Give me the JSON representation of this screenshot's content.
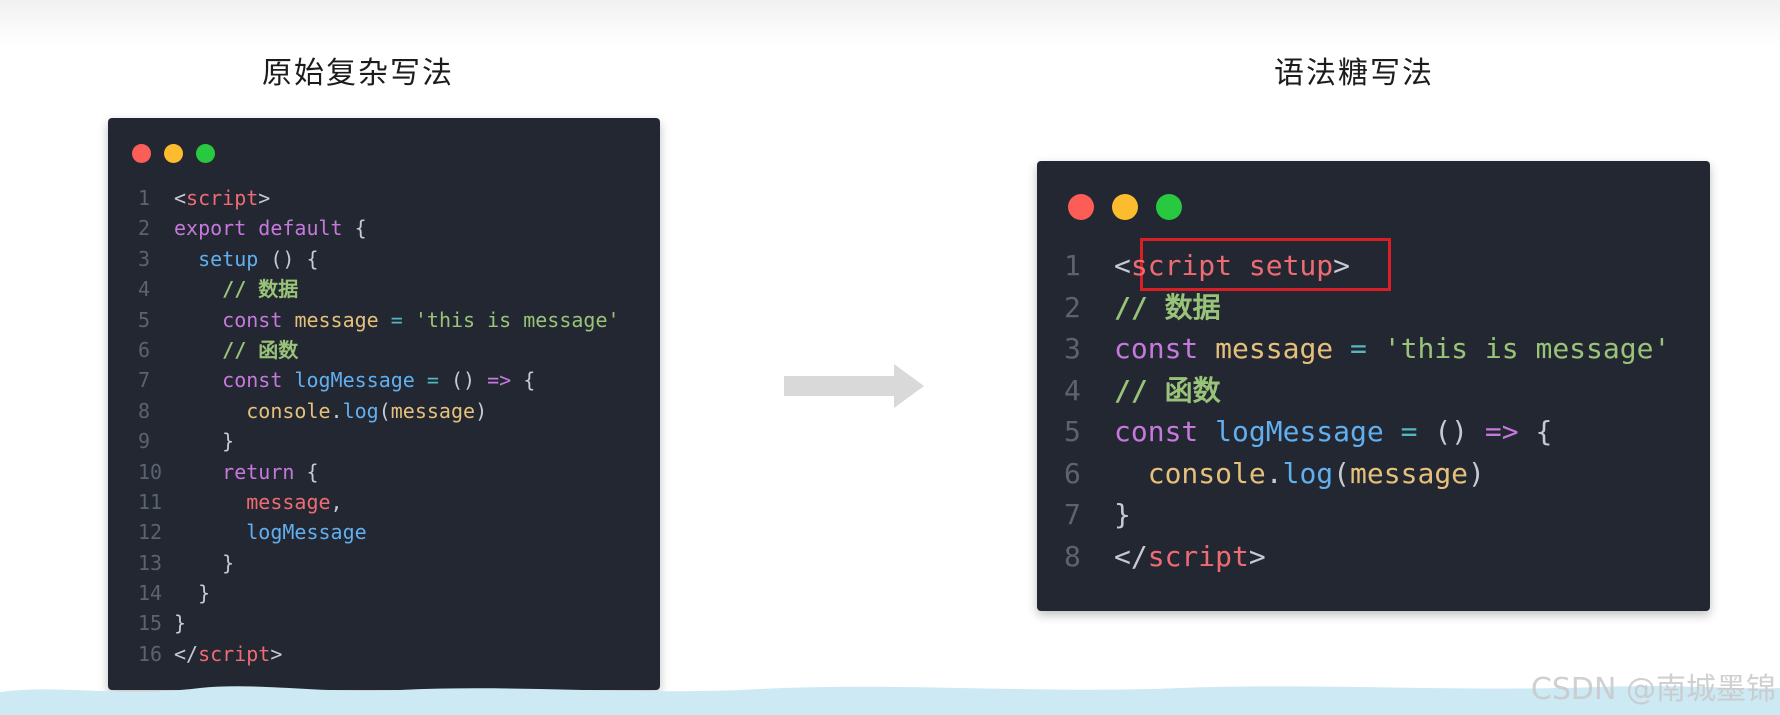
{
  "headings": {
    "left": "原始复杂写法",
    "right": "语法糖写法"
  },
  "colors": {
    "window_bg": "#232731",
    "dot_red": "#fc5d57",
    "dot_yellow": "#fdbc2e",
    "dot_green": "#28c840",
    "highlight_border": "#d81f26",
    "arrow": "#d9d9d9",
    "band": "#cde9f3"
  },
  "left_code": [
    [
      {
        "t": "<",
        "c": "t-punct"
      },
      {
        "t": "script",
        "c": "t-tag"
      },
      {
        "t": ">",
        "c": "t-punct"
      }
    ],
    [
      {
        "t": "export default",
        "c": "t-kw"
      },
      {
        "t": " {",
        "c": "t-punct"
      }
    ],
    [
      {
        "t": "  "
      },
      {
        "t": "setup",
        "c": "t-fn"
      },
      {
        "t": " () {",
        "c": "t-punct"
      }
    ],
    [
      {
        "t": "    "
      },
      {
        "t": "// 数据",
        "c": "t-comment"
      }
    ],
    [
      {
        "t": "    "
      },
      {
        "t": "const",
        "c": "t-kw"
      },
      {
        "t": " "
      },
      {
        "t": "message",
        "c": "t-var"
      },
      {
        "t": " = ",
        "c": "t-op"
      },
      {
        "t": "'this is message'",
        "c": "t-str"
      }
    ],
    [
      {
        "t": "    "
      },
      {
        "t": "// 函数",
        "c": "t-comment"
      }
    ],
    [
      {
        "t": "    "
      },
      {
        "t": "const",
        "c": "t-kw"
      },
      {
        "t": " "
      },
      {
        "t": "logMessage",
        "c": "t-fn"
      },
      {
        "t": " = ",
        "c": "t-op"
      },
      {
        "t": "() ",
        "c": "t-punct"
      },
      {
        "t": "=>",
        "c": "t-kw"
      },
      {
        "t": " {",
        "c": "t-punct"
      }
    ],
    [
      {
        "t": "      "
      },
      {
        "t": "console",
        "c": "t-obj"
      },
      {
        "t": ".",
        "c": "t-punct"
      },
      {
        "t": "log",
        "c": "t-fn"
      },
      {
        "t": "(",
        "c": "t-punct"
      },
      {
        "t": "message",
        "c": "t-var"
      },
      {
        "t": ")",
        "c": "t-punct"
      }
    ],
    [
      {
        "t": "    "
      },
      {
        "t": "}",
        "c": "t-punct"
      }
    ],
    [
      {
        "t": "    "
      },
      {
        "t": "return",
        "c": "t-kw"
      },
      {
        "t": " {",
        "c": "t-punct"
      }
    ],
    [
      {
        "t": "      "
      },
      {
        "t": "message",
        "c": "t-prop"
      },
      {
        "t": ",",
        "c": "t-punct"
      }
    ],
    [
      {
        "t": "      "
      },
      {
        "t": "logMessage",
        "c": "t-fn"
      }
    ],
    [
      {
        "t": "    "
      },
      {
        "t": "}",
        "c": "t-punct"
      }
    ],
    [
      {
        "t": "  "
      },
      {
        "t": "}",
        "c": "t-punct"
      }
    ],
    [
      {
        "t": "}",
        "c": "t-punct"
      }
    ],
    [
      {
        "t": "</",
        "c": "t-punct"
      },
      {
        "t": "script",
        "c": "t-tag"
      },
      {
        "t": ">",
        "c": "t-punct"
      }
    ]
  ],
  "right_code": [
    [
      {
        "t": "<",
        "c": "t-punct"
      },
      {
        "t": "script setup",
        "c": "t-tag"
      },
      {
        "t": ">",
        "c": "t-punct"
      }
    ],
    [
      {
        "t": "// 数据",
        "c": "t-comment"
      }
    ],
    [
      {
        "t": "const",
        "c": "t-kw"
      },
      {
        "t": " "
      },
      {
        "t": "message",
        "c": "t-var"
      },
      {
        "t": " = ",
        "c": "t-op"
      },
      {
        "t": "'this is message'",
        "c": "t-str"
      }
    ],
    [
      {
        "t": "// 函数",
        "c": "t-comment"
      }
    ],
    [
      {
        "t": "const",
        "c": "t-kw"
      },
      {
        "t": " "
      },
      {
        "t": "logMessage",
        "c": "t-fn"
      },
      {
        "t": " = ",
        "c": "t-op"
      },
      {
        "t": "() ",
        "c": "t-punct"
      },
      {
        "t": "=>",
        "c": "t-kw"
      },
      {
        "t": " {",
        "c": "t-punct"
      }
    ],
    [
      {
        "t": "  "
      },
      {
        "t": "console",
        "c": "t-obj"
      },
      {
        "t": ".",
        "c": "t-punct"
      },
      {
        "t": "log",
        "c": "t-fn"
      },
      {
        "t": "(",
        "c": "t-punct"
      },
      {
        "t": "message",
        "c": "t-var"
      },
      {
        "t": ")",
        "c": "t-punct"
      }
    ],
    [
      {
        "t": "}",
        "c": "t-punct"
      }
    ],
    [
      {
        "t": "</",
        "c": "t-punct"
      },
      {
        "t": "script",
        "c": "t-tag"
      },
      {
        "t": ">",
        "c": "t-punct"
      }
    ]
  ],
  "arrow_icon": "right-arrow-icon",
  "watermark": "CSDN @南城墨锦"
}
